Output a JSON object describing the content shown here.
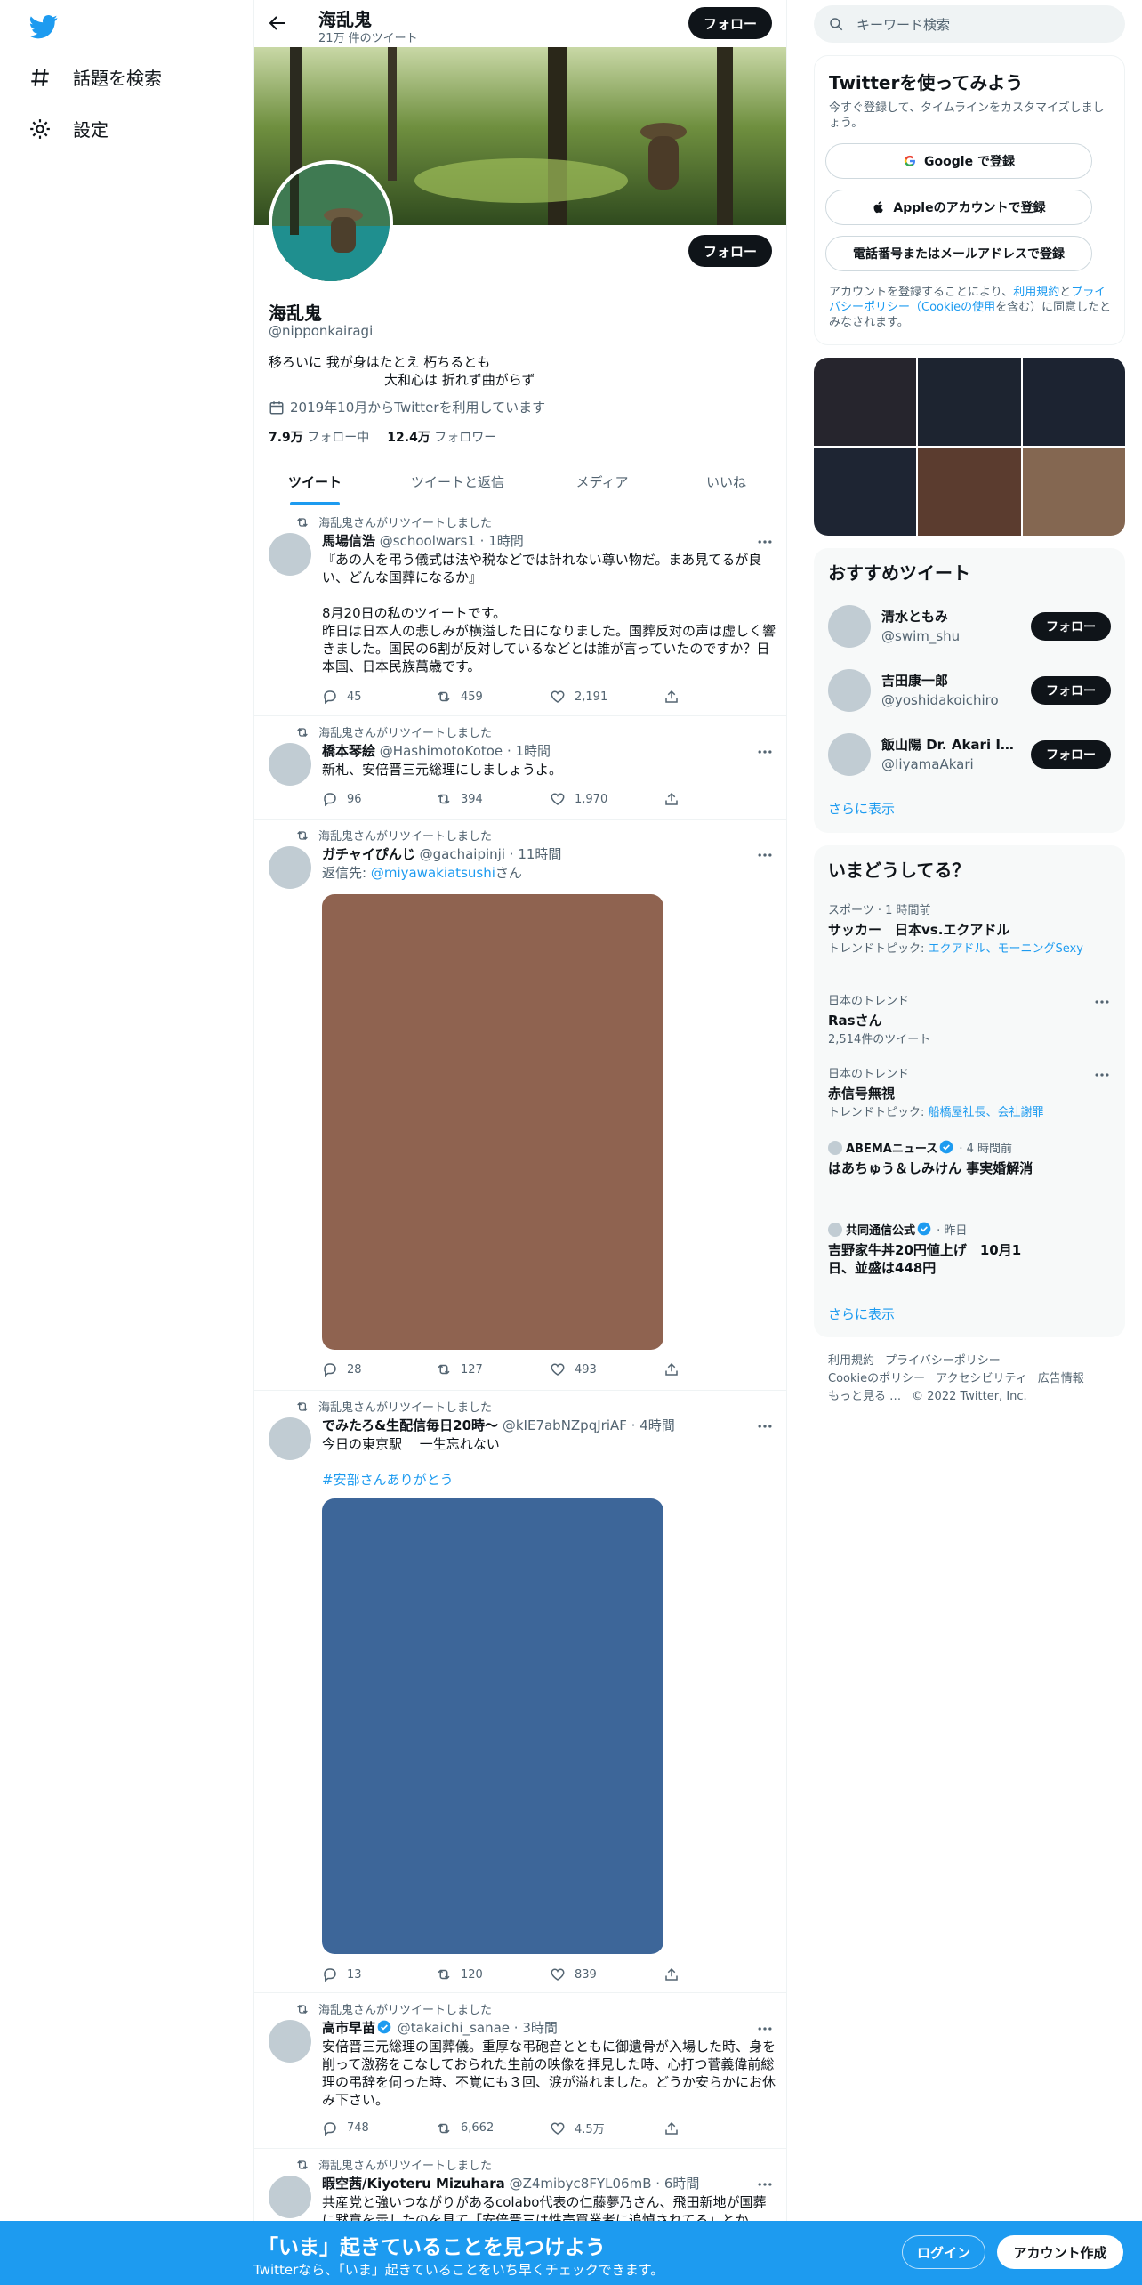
{
  "nav": {
    "explore_label": "話題を検索",
    "settings_label": "設定"
  },
  "header": {
    "name": "海乱鬼",
    "tweet_count": "21万 件のツイート",
    "follow_label": "フォロー"
  },
  "profile": {
    "name": "海乱鬼",
    "handle": "@nipponkairagi",
    "bio_line1": "移ろいに 我が身はたとえ 朽ちるとも",
    "bio_line2": "大和心は 折れず曲がらず",
    "joined": "2019年10月からTwitterを利用しています",
    "following_count": "7.9万",
    "following_label": "フォロー中",
    "followers_count": "12.4万",
    "followers_label": "フォロワー",
    "follow_label": "フォロー"
  },
  "tabs": [
    "ツイート",
    "ツイートと返信",
    "メディア",
    "いいね"
  ],
  "tweets": [
    {
      "retweet_label": "海乱鬼さんがリツイートしました",
      "name": "馬場信浩",
      "handle": "@schoolwars1",
      "time": "1時間",
      "text": "『あの人を弔う儀式は法や税などでは計れない尊い物だ。まあ見てるが良い、どんな国葬になるか』\n\n8月20日の私のツイートです。\n昨日は日本人の悲しみが横溢した日になりました。国葬反対の声は虚しく響きました。国民の6割が反対しているなどとは誰が言っていたのですか？日本国、日本民族萬歳です。",
      "replies": "45",
      "retweets": "459",
      "likes": "2,191"
    },
    {
      "retweet_label": "海乱鬼さんがリツイートしました",
      "name": "橋本琴絵",
      "handle": "@HashimotoKotoe",
      "time": "1時間",
      "text": "新札、安倍晋三元総理にしましょうよ。",
      "replies": "96",
      "retweets": "394",
      "likes": "1,970"
    },
    {
      "retweet_label": "海乱鬼さんがリツイートしました",
      "name": "ガチャイぴんじ",
      "handle": "@gachaipinji",
      "time": "11時間",
      "reply_to_prefix": "返信先: ",
      "reply_to": "@miyawakiatsushi",
      "reply_to_suffix": "さん",
      "media_color": "#8f6350",
      "replies": "28",
      "retweets": "127",
      "likes": "493"
    },
    {
      "retweet_label": "海乱鬼さんがリツイートしました",
      "name": "でみたろ&生配信毎日20時～",
      "handle": "@kIE7abNZpqJriAF",
      "time": "4時間",
      "text": "今日の東京駅　 一生忘れない",
      "hashtag": "#安部さんありがとう",
      "media_color": "#3d6699",
      "replies": "13",
      "retweets": "120",
      "likes": "839"
    },
    {
      "retweet_label": "海乱鬼さんがリツイートしました",
      "name": "高市早苗",
      "handle": "@takaichi_sanae",
      "time": "3時間",
      "text": "安倍晋三元総理の国葬儀。重厚な弔砲音とともに御遺骨が入場した時、身を削って激務をこなしておられた生前の映像を拝見した時、心打つ菅義偉前総理の弔辞を伺った時、不覚にも３回、涙が溢れました。どうか安らかにお休み下さい。",
      "replies": "748",
      "retweets": "6,662",
      "likes": "4.5万"
    },
    {
      "retweet_label": "海乱鬼さんがリツイートしました",
      "name": "暇空茜/Kiyoteru Mizuhara",
      "handle": "@Z4mibyc8FYL06mB",
      "time": "6時間",
      "text": "共産党と強いつながりがあるcolabo代表の仁藤夢乃さん、飛田新地が国葬に黙意を示したのを見て「安倍晋三は性売買業者に追悼されてる」とか"
    }
  ],
  "right": {
    "search_placeholder": "キーワード検索",
    "signup": {
      "title": "Twitterを使ってみよう",
      "subtitle": "今すぐ登録して、タイムラインをカスタマイズしましょう。",
      "google": "Google で登録",
      "apple": "Appleのアカウントで登録",
      "phone": "電話番号またはメールアドレスで登録",
      "legal_prefix": "アカウントを登録することにより、",
      "legal_terms": "利用規約",
      "legal_and": "と",
      "legal_privacy": "プライバシーポリシー（Cookieの使用",
      "legal_suffix": "を含む）に同意したとみなされます。"
    },
    "photos": [
      "#26252d",
      "#1d2430",
      "#1c2331",
      "#1e2533",
      "#5b3c2f",
      "#846751"
    ],
    "recommended": {
      "title": "おすすめツイート",
      "users": [
        {
          "name": "清水ともみ",
          "handle": "@swim_shu",
          "follow": "フォロー"
        },
        {
          "name": "吉田康一郎",
          "handle": "@yoshidakoichiro",
          "follow": "フォロー"
        },
        {
          "name": "飯山陽 Dr. Akari IIYAMA",
          "handle": "@IiyamaAkari",
          "follow": "フォロー"
        }
      ],
      "more": "さらに表示"
    },
    "trends": {
      "title": "いまどうしてる？",
      "items": [
        {
          "meta": "スポーツ · 1 時間前",
          "title": "サッカー　日本vs.エクアドル",
          "sub_prefix": "トレンドトピック: ",
          "sub_link": "エクアドル、モーニングSexy"
        },
        {
          "meta": "日本のトレンド",
          "title": "Rasさん",
          "sub": "2,514件のツイート"
        },
        {
          "meta": "日本のトレンド",
          "title": "赤信号無視",
          "sub_prefix": "トレンドトピック: ",
          "sub_link": "船橋屋社長、会社謝罪"
        },
        {
          "source": "ABEMAニュース",
          "time": "· 4 時間前",
          "title": "はあちゅう＆しみけん 事実婚解消"
        },
        {
          "source": "共同通信公式",
          "time": "· 昨日",
          "title": "吉野家牛丼20円値上げ　10月1日、並盛は448円"
        }
      ],
      "more": "さらに表示"
    },
    "footer": [
      "利用規約",
      "プライバシーポリシー",
      "Cookieのポリシー",
      "アクセシビリティ",
      "広告情報",
      "もっと見る …",
      "© 2022 Twitter, Inc."
    ]
  },
  "bottom": {
    "title": "「いま」起きていることを見つけよう",
    "subtitle": "Twitterなら、「いま」起きていることをいち早くチェックできます。",
    "login": "ログイン",
    "signup": "アカウント作成"
  },
  "colors": {
    "accent": "#1d9bf0",
    "dark": "#0f1419",
    "muted": "#536471"
  }
}
